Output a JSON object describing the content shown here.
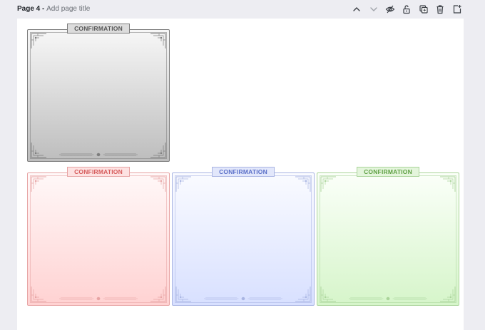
{
  "header": {
    "page_number": "Page 4",
    "separator": " - ",
    "title_placeholder": "Add page title"
  },
  "toolbar": {
    "icons": [
      "chevron-up-icon",
      "chevron-down-icon",
      "eye-icon",
      "lock-icon",
      "duplicate-icon",
      "trash-icon",
      "add-page-icon"
    ]
  },
  "cards": [
    {
      "label": "CONFIRMATION",
      "theme": "gray",
      "border": "#7d7d7d",
      "tag_bg": "#dcdcdc",
      "tag_text": "#555555",
      "top": "#f7f7f7",
      "bottom": "#bdbdbd"
    },
    {
      "label": "CONFIRMATION",
      "theme": "red",
      "border": "#e7a4a4",
      "tag_bg": "#fde2e2",
      "tag_text": "#d65b5b",
      "top": "#fff8f8",
      "bottom": "#ffd2d2"
    },
    {
      "label": "CONFIRMATION",
      "theme": "blue",
      "border": "#a9b5e3",
      "tag_bg": "#e2e7fb",
      "tag_text": "#5b70c8",
      "top": "#fafbff",
      "bottom": "#d8e0ff"
    },
    {
      "label": "CONFIRMATION",
      "theme": "green",
      "border": "#aad49a",
      "tag_bg": "#e4f5dc",
      "tag_text": "#5fa144",
      "top": "#fbfff9",
      "bottom": "#d6f5ca"
    }
  ]
}
